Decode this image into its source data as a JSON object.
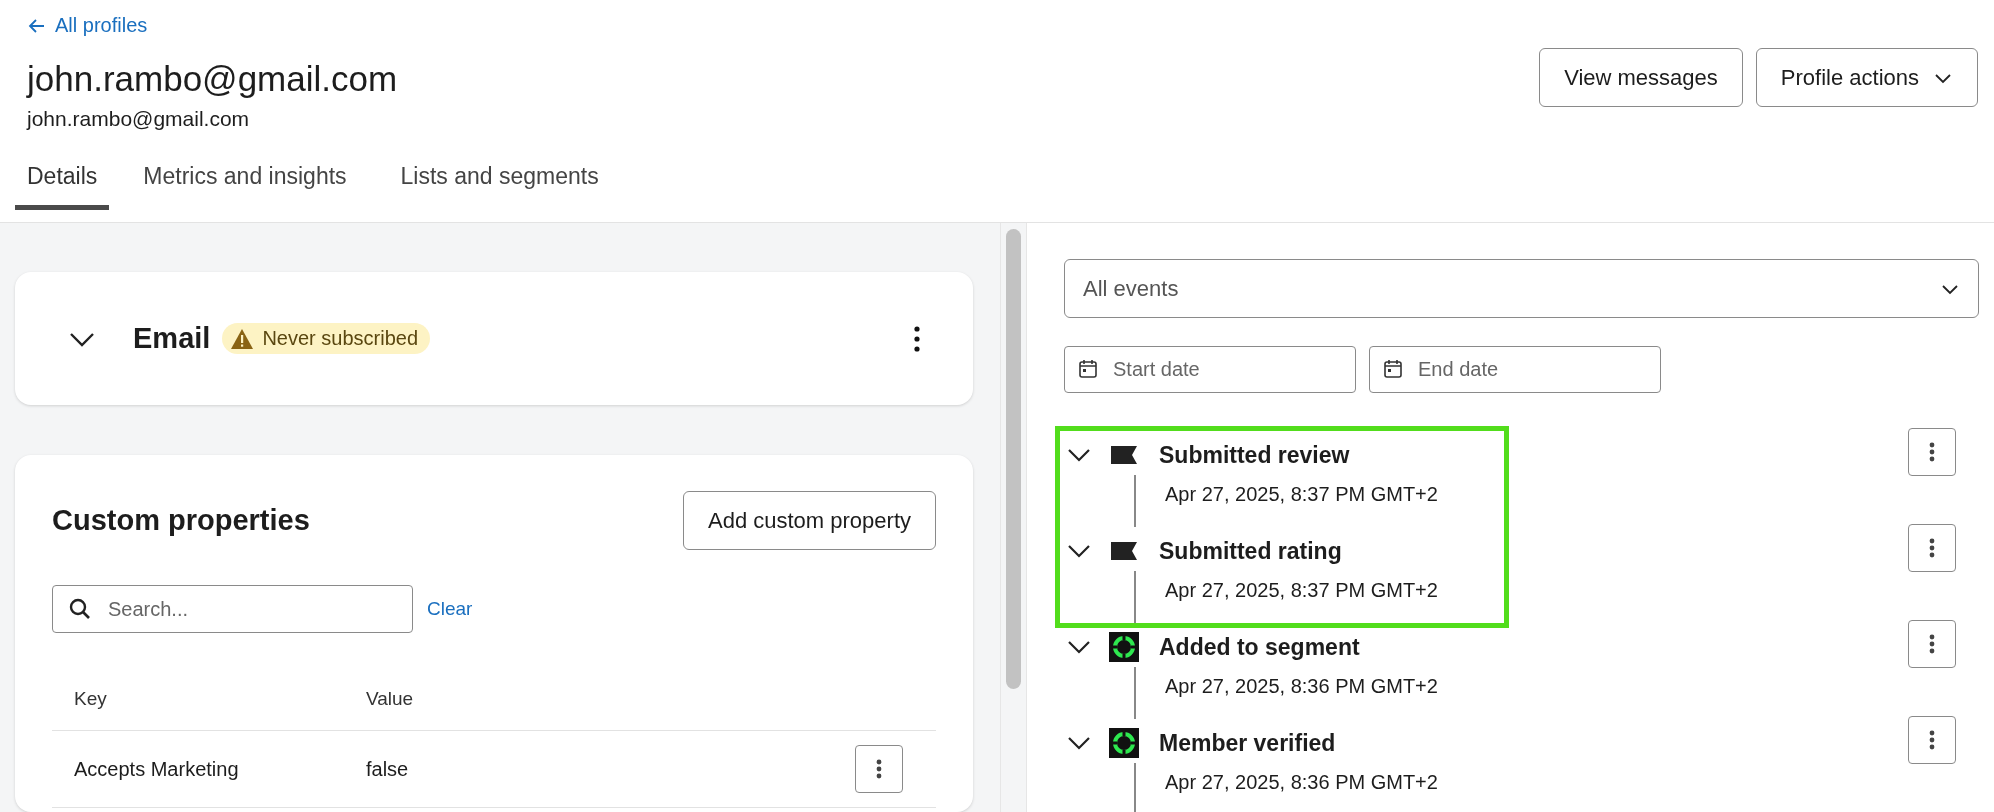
{
  "back_link": {
    "label": "All profiles"
  },
  "profile": {
    "title": "john.rambo@gmail.com",
    "subtitle": "john.rambo@gmail.com"
  },
  "header_buttons": [
    {
      "label": "View messages",
      "kind": "plain"
    },
    {
      "label": "Profile actions",
      "kind": "dropdown"
    }
  ],
  "tabs": [
    {
      "label": "Details",
      "selected": true
    },
    {
      "label": "Metrics and insights",
      "selected": false
    },
    {
      "label": "Lists and segments",
      "selected": false
    }
  ],
  "email_card": {
    "title": "Email",
    "expanded": true,
    "badge": "Never subscribed"
  },
  "custom_properties": {
    "title": "Custom properties",
    "add_button": "Add custom property",
    "search": {
      "placeholder": "Search..."
    },
    "clear_link": "Clear",
    "columns": [
      "Key",
      "Value"
    ],
    "rows": [
      {
        "key": "Accepts Marketing",
        "value": "false"
      }
    ]
  },
  "event_filter": {
    "value": "All events"
  },
  "date_range": [
    {
      "placeholder": "Start date"
    },
    {
      "placeholder": "End date"
    }
  ],
  "events": [
    {
      "kind": "flag",
      "title": "Submitted review",
      "time": "Apr 27, 2025, 8:37 PM GMT+2",
      "highlighted": true
    },
    {
      "kind": "flag",
      "title": "Submitted rating",
      "time": "Apr 27, 2025, 8:37 PM GMT+2",
      "highlighted": true
    },
    {
      "kind": "target",
      "title": "Added to segment",
      "time": "Apr 27, 2025, 8:36 PM GMT+2",
      "highlighted": false
    },
    {
      "kind": "target",
      "title": "Member verified",
      "time": "Apr 27, 2025, 8:36 PM GMT+2",
      "highlighted": false
    }
  ]
}
